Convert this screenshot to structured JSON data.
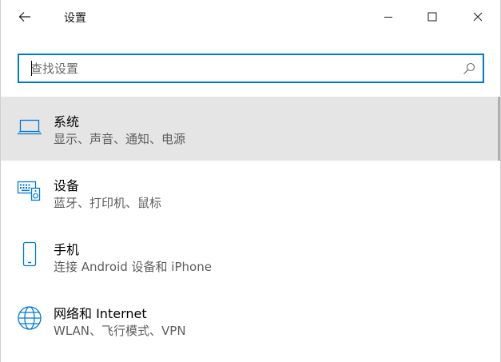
{
  "window": {
    "title": "设置"
  },
  "search": {
    "placeholder": "查找设置",
    "value": ""
  },
  "items": [
    {
      "title": "系统",
      "subtitle": "显示、声音、通知、电源",
      "icon": "laptop-icon",
      "selected": true
    },
    {
      "title": "设备",
      "subtitle": "蓝牙、打印机、鼠标",
      "icon": "devices-icon",
      "selected": false
    },
    {
      "title": "手机",
      "subtitle": "连接 Android 设备和 iPhone",
      "icon": "phone-icon",
      "selected": false
    },
    {
      "title": "网络和 Internet",
      "subtitle": "WLAN、飞行模式、VPN",
      "icon": "globe-icon",
      "selected": false
    }
  ],
  "colors": {
    "accent": "#0078d7",
    "selected_bg": "#e5e5e5",
    "subtitle_text": "#5d5d5d"
  }
}
